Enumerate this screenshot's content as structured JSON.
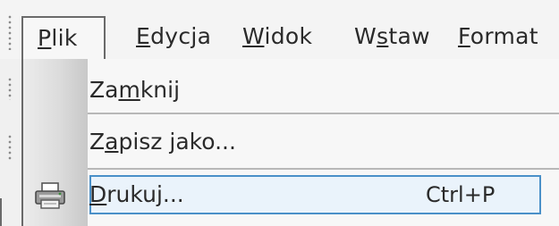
{
  "menubar": {
    "items": [
      {
        "pre": "",
        "ul": "P",
        "post": "lik"
      },
      {
        "pre": "",
        "ul": "E",
        "post": "dycja"
      },
      {
        "pre": "",
        "ul": "W",
        "post": "idok"
      },
      {
        "pre": "W",
        "ul": "s",
        "post": "taw"
      },
      {
        "pre": "",
        "ul": "F",
        "post": "ormat"
      }
    ]
  },
  "file_menu": {
    "items": [
      {
        "pre": "Za",
        "ul": "m",
        "post": "knij"
      },
      {
        "pre": "Z",
        "ul": "a",
        "post": "pisz jako..."
      },
      {
        "pre": "",
        "ul": "D",
        "post": "rukuj...",
        "shortcut": "Ctrl+P",
        "icon": "printer-icon"
      }
    ]
  },
  "colors": {
    "highlight_border": "#4a90c8",
    "highlight_fill": "#eaf3fb",
    "menu_border": "#6a6a6a"
  }
}
